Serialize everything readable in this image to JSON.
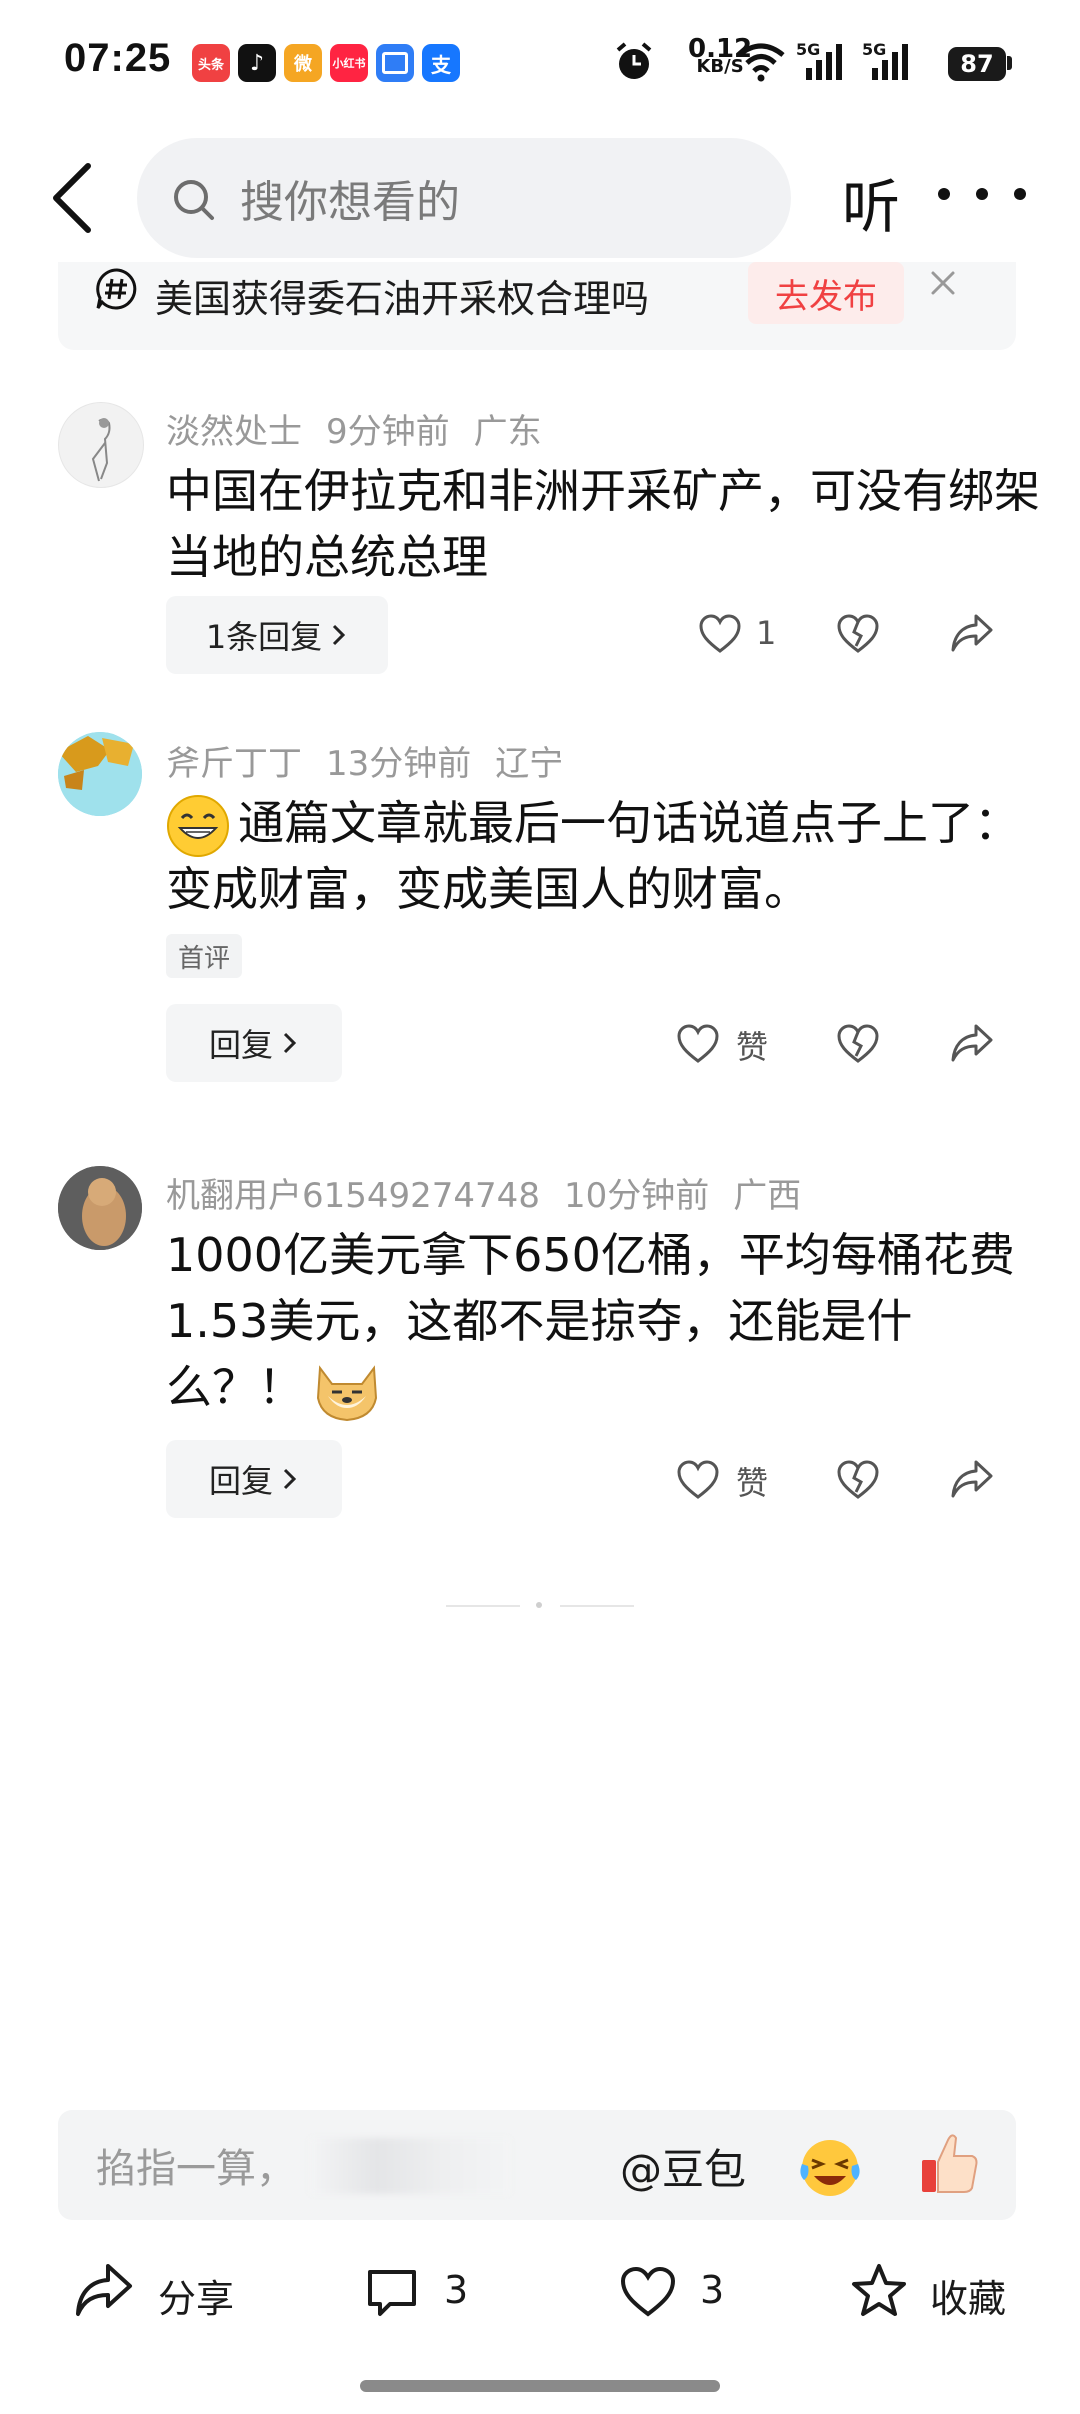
{
  "status_bar": {
    "time": "07:25",
    "apps": [
      {
        "name": "toutiao-icon",
        "label": "头条",
        "color": "#f04142"
      },
      {
        "name": "douyin-icon",
        "label": "♪",
        "color": "#111111"
      },
      {
        "name": "weibo-icon",
        "label": "微",
        "color": "#f5a623"
      },
      {
        "name": "xiaohongshu-icon",
        "label": "小红书",
        "color": "#ff2442"
      },
      {
        "name": "files-icon",
        "label": "",
        "color": "#2f7df6"
      },
      {
        "name": "alipay-icon",
        "label": "支",
        "color": "#1677ff"
      }
    ],
    "net_speed_value": "0.12",
    "net_speed_unit": "KB/S",
    "signal_1": "5G",
    "signal_2": "5G",
    "battery": "87"
  },
  "header": {
    "search_placeholder": "搜你想看的",
    "listen_label": "听"
  },
  "topic": {
    "text": "美国获得委石油开采权合理吗",
    "publish_label": "去发布"
  },
  "comments": [
    {
      "username": "淡然处士",
      "time": "9分钟前",
      "location": "广东",
      "content": "中国在伊拉克和非洲开采矿产，可没有绑架当地的总统总理",
      "reply_label": "1条回复",
      "like_label": "1"
    },
    {
      "username": "斧斤丁丁",
      "time": "13分钟前",
      "location": "辽宁",
      "content": "通篇文章就最后一句话说道点子上了：变成财富，变成美国人的财富。",
      "tag": "首评",
      "reply_label": "回复",
      "like_label": "赞"
    },
    {
      "username": "机翻用户61549274748",
      "time": "10分钟前",
      "location": "广西",
      "content": "1000亿美元拿下650亿桶，平均每桶花费1.53美元，这都不是掠夺，还能是什么？！",
      "reply_label": "回复",
      "like_label": "赞"
    }
  ],
  "input": {
    "placeholder": "掐指一算，",
    "mention_label": "@豆包"
  },
  "bottom_bar": {
    "share_label": "分享",
    "comment_count": "3",
    "like_count": "3",
    "favorite_label": "收藏"
  },
  "colors": {
    "accent_red": "#f04142",
    "icon_gray": "#555555"
  }
}
